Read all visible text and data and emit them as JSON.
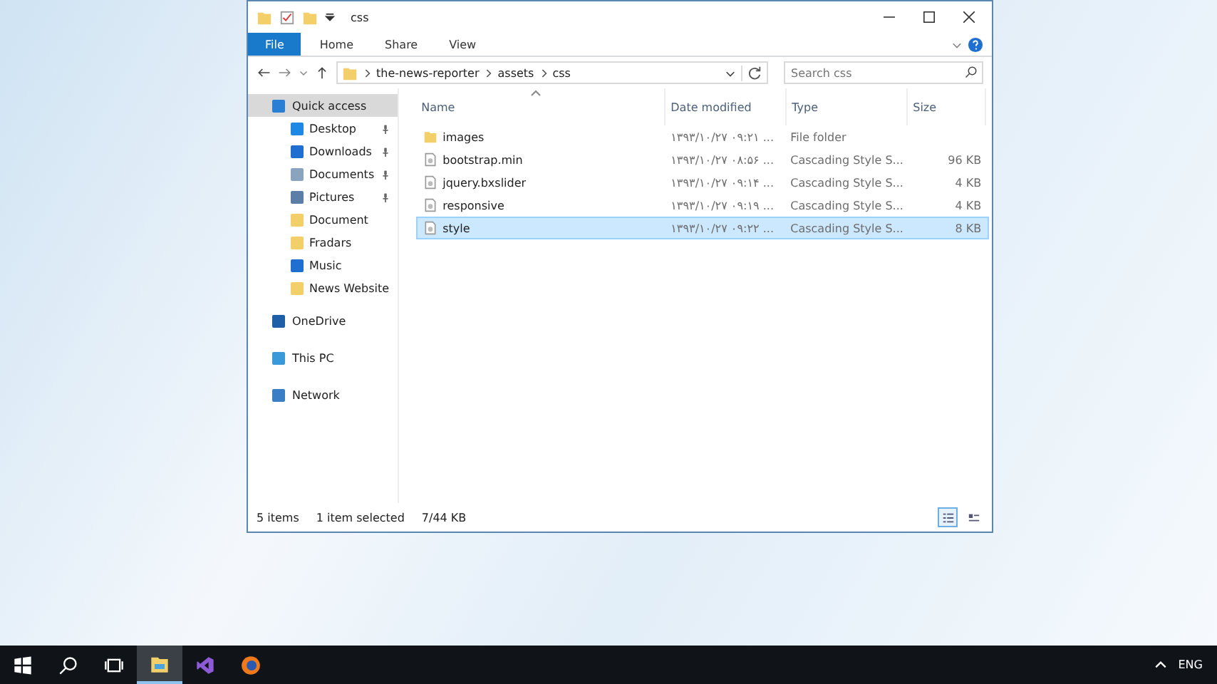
{
  "window": {
    "title": "css"
  },
  "ribbon_tabs": [
    {
      "label": "File",
      "selected": true
    },
    {
      "label": "Home",
      "selected": false
    },
    {
      "label": "Share",
      "selected": false
    },
    {
      "label": "View",
      "selected": false
    }
  ],
  "address": {
    "segments": [
      "the-news-reporter",
      "assets",
      "css"
    ]
  },
  "search": {
    "placeholder": "Search css"
  },
  "nav": [
    {
      "label": "Quick access",
      "kind": "star",
      "selected": true,
      "children": [
        {
          "label": "Desktop",
          "kind": "desktop",
          "pinned": true
        },
        {
          "label": "Downloads",
          "kind": "download",
          "pinned": true
        },
        {
          "label": "Documents",
          "kind": "document",
          "pinned": true
        },
        {
          "label": "Pictures",
          "kind": "picture",
          "pinned": true
        },
        {
          "label": "Document",
          "kind": "folder",
          "pinned": false
        },
        {
          "label": "Fradars",
          "kind": "folder",
          "pinned": false
        },
        {
          "label": "Music",
          "kind": "music",
          "pinned": false
        },
        {
          "label": "News Website",
          "kind": "folder",
          "pinned": false
        }
      ]
    },
    {
      "label": "OneDrive",
      "kind": "cloud",
      "selected": false
    },
    {
      "label": "This PC",
      "kind": "pc",
      "selected": false
    },
    {
      "label": "Network",
      "kind": "network",
      "selected": false
    }
  ],
  "columns": [
    {
      "label": "Name",
      "sorted": true
    },
    {
      "label": "Date modified",
      "sorted": false
    },
    {
      "label": "Type",
      "sorted": false
    },
    {
      "label": "Size",
      "sorted": false
    }
  ],
  "files": [
    {
      "name": "images",
      "kind": "folder",
      "date": "۱۳۹۳/۱۰/۲۷ ۰۹:۲۱ ...",
      "type": "File folder",
      "selected": false
    },
    {
      "name": "bootstrap.min",
      "kind": "css",
      "date": "۱۳۹۳/۱۰/۲۷ ۰۸:۵۶ ...",
      "type": "Cascading Style S...",
      "size": "96 KB",
      "selected": false
    },
    {
      "name": "jquery.bxslider",
      "kind": "css",
      "date": "۱۳۹۳/۱۰/۲۷ ۰۹:۱۴ ...",
      "type": "Cascading Style S...",
      "size": "4 KB",
      "selected": false
    },
    {
      "name": "responsive",
      "kind": "css",
      "date": "۱۳۹۳/۱۰/۲۷ ۰۹:۱۹ ...",
      "type": "Cascading Style S...",
      "size": "4 KB",
      "selected": false
    },
    {
      "name": "style",
      "kind": "css",
      "date": "۱۳۹۳/۱۰/۲۷ ۰۹:۲۲ ...",
      "type": "Cascading Style S...",
      "size": "8 KB",
      "selected": true
    }
  ],
  "status_bar": {
    "count": "5 items",
    "selection": "1 item selected",
    "size": "7/44 KB"
  },
  "views": [
    {
      "kind": "details",
      "selected": true
    },
    {
      "kind": "tiles",
      "selected": false
    }
  ],
  "taskbar": {
    "apps": [
      {
        "kind": "explorer",
        "active": true
      },
      {
        "kind": "studio",
        "active": false
      },
      {
        "kind": "browser",
        "active": false
      }
    ],
    "language": "ENG"
  }
}
